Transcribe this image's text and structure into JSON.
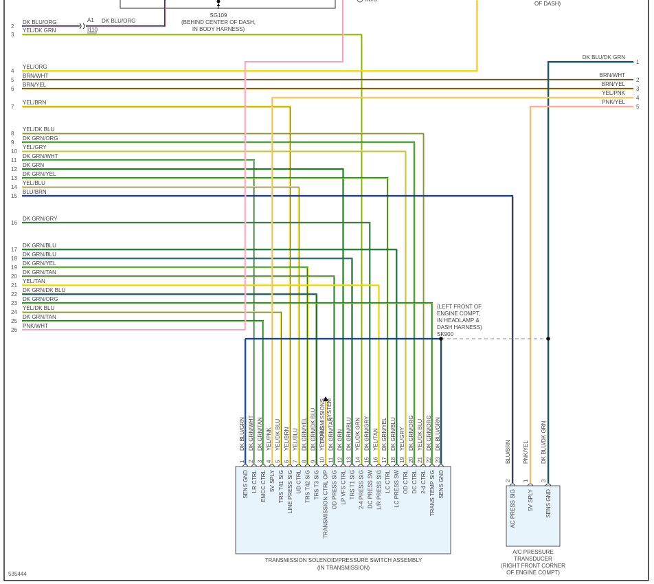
{
  "diagram_id": "535444",
  "colors": {
    "DK BLU": "#1a3a9c",
    "BLU": "#4a5ee0",
    "YEL": "#f2e600",
    "DK GRN": "#1f7f1f",
    "WHT": "#dddddd",
    "ORG": "#f2a050",
    "BRN": "#6b4a10",
    "GRY": "#9a9a9a",
    "TAN": "#d2b48c",
    "PNK": "#f4a0b8",
    "box_fill": "#e8f4fb"
  },
  "top": {
    "splice_id": "SG109",
    "splice_location": [
      "(BEHIND CENTER OF DASH,",
      "IN BODY HARNESS)"
    ],
    "awd_label": "AWD",
    "right_location_tail": "OF DASH)",
    "connector_a1": "A1",
    "connector_i110": "I110",
    "row2_right_label": "DK BLU/ORG"
  },
  "left_connector": {
    "wires": [
      {
        "cavity": "2",
        "label": "DK BLU/ORG",
        "colors": [
          "DK BLU",
          "ORG"
        ]
      },
      {
        "cavity": "3",
        "label": "YEL/DK GRN",
        "colors": [
          "YEL",
          "DK GRN"
        ]
      },
      {
        "cavity": "4",
        "label": "YEL/ORG",
        "colors": [
          "YEL",
          "ORG"
        ]
      },
      {
        "cavity": "5",
        "label": "BRN/WHT",
        "colors": [
          "BRN",
          "WHT"
        ],
        "to_right": "2"
      },
      {
        "cavity": "6",
        "label": "BRN/YEL",
        "colors": [
          "BRN",
          "YEL"
        ],
        "to_right": "3"
      },
      {
        "cavity": "7",
        "label": "YEL/BRN",
        "colors": [
          "YEL",
          "BRN"
        ],
        "to_pin": 6
      },
      {
        "cavity": "8",
        "label": "YEL/DK BLU",
        "colors": [
          "YEL",
          "DK BLU"
        ],
        "to_pin": 21
      },
      {
        "cavity": "9",
        "label": "DK GRN/ORG",
        "colors": [
          "DK GRN",
          "ORG"
        ],
        "to_pin": 20
      },
      {
        "cavity": "10",
        "label": "YEL/GRY",
        "colors": [
          "YEL",
          "GRY"
        ],
        "to_pin": 19
      },
      {
        "cavity": "11",
        "label": "DK GRN/WHT",
        "colors": [
          "DK GRN",
          "WHT"
        ],
        "to_pin": 2
      },
      {
        "cavity": "12",
        "label": "DK GRN",
        "colors": [
          "DK GRN",
          "DK GRN"
        ],
        "to_pin": 12
      },
      {
        "cavity": "13",
        "label": "DK GRN/YEL",
        "colors": [
          "DK GRN",
          "YEL"
        ],
        "to_pin": 17
      },
      {
        "cavity": "14",
        "label": "YEL/BLU",
        "colors": [
          "YEL",
          "BLU"
        ],
        "to_pin": 7
      },
      {
        "cavity": "15",
        "label": "BLU/BRN",
        "colors": [
          "DK BLU",
          "BRN"
        ],
        "to_ac_pin": "2"
      },
      {
        "cavity": "16",
        "label": "DK GRN/GRY",
        "colors": [
          "DK GRN",
          "GRY"
        ],
        "to_pin": 15
      },
      {
        "cavity": "17",
        "label": "DK GRN/BLU",
        "colors": [
          "DK GRN",
          "BLU"
        ],
        "to_pin": 18
      },
      {
        "cavity": "18",
        "label": "DK GRN/BLU",
        "colors": [
          "DK GRN",
          "BLU"
        ],
        "to_pin": 13
      },
      {
        "cavity": "19",
        "label": "DK GRN/YEL",
        "colors": [
          "DK GRN",
          "YEL"
        ],
        "to_pin": 8
      },
      {
        "cavity": "20",
        "label": "DK GRN/TAN",
        "colors": [
          "DK GRN",
          "TAN"
        ],
        "to_pin": 11
      },
      {
        "cavity": "21",
        "label": "YEL/TAN",
        "colors": [
          "YEL",
          "TAN"
        ],
        "to_pin": 16
      },
      {
        "cavity": "22",
        "label": "DK GRN/DK BLU",
        "colors": [
          "DK GRN",
          "DK BLU"
        ],
        "to_pin": 9
      },
      {
        "cavity": "23",
        "label": "DK GRN/ORG",
        "colors": [
          "DK GRN",
          "ORG"
        ],
        "to_pin": 22
      },
      {
        "cavity": "24",
        "label": "YEL/DK BLU",
        "colors": [
          "YEL",
          "DK BLU"
        ],
        "to_pin": 5
      },
      {
        "cavity": "25",
        "label": "DK GRN/TAN",
        "colors": [
          "DK GRN",
          "TAN"
        ],
        "to_pin": 3
      },
      {
        "cavity": "26",
        "label": "PNK/WHT",
        "colors": [
          "PNK",
          "WHT"
        ]
      }
    ]
  },
  "right_connector": {
    "wires": [
      {
        "cavity": "1",
        "label": "DK BLU/DK GRN",
        "colors": [
          "DK BLU",
          "DK GRN"
        ]
      },
      {
        "cavity": "2",
        "label": "BRN/WHT",
        "colors": [
          "BRN",
          "WHT"
        ]
      },
      {
        "cavity": "3",
        "label": "BRN/YEL",
        "colors": [
          "BRN",
          "YEL"
        ]
      },
      {
        "cavity": "4",
        "label": "YEL/PNK",
        "colors": [
          "YEL",
          "PNK"
        ]
      },
      {
        "cavity": "5",
        "label": "PNK/YEL",
        "colors": [
          "PNK",
          "YEL"
        ]
      }
    ]
  },
  "splice_sk900": {
    "id": "SK900",
    "location": [
      "(LEFT FRONT OF",
      "ENGINE COMPT,",
      "IN HEADLAMP &",
      "DASH HARNESS)"
    ]
  },
  "arrow_note": [
    "TRANSMISSIONS",
    "SYSTEM"
  ],
  "solenoid_assembly": {
    "title": "TRANSMISSION SOLENOID/PRESSURE SWITCH ASSEMBLY",
    "subtitle": "(IN TRANSMISSION)",
    "pins": [
      {
        "pin": "1",
        "wire": "DK BLU/GRN",
        "function": "SENS GND",
        "colors": [
          "DK BLU",
          "DK GRN"
        ]
      },
      {
        "pin": "2",
        "wire": "DK GRN/WHT",
        "function": "LR CTRL",
        "colors": [
          "DK GRN",
          "WHT"
        ]
      },
      {
        "pin": "3",
        "wire": "DK GRN/TAN",
        "function": "EMCC CTRL",
        "colors": [
          "DK GRN",
          "TAN"
        ]
      },
      {
        "pin": "4",
        "wire": "YEL/PNK",
        "function": "5V SPLY",
        "colors": [
          "YEL",
          "PNK"
        ]
      },
      {
        "pin": "5",
        "wire": "YEL/DK BLU",
        "function": "TRS T41 SIG",
        "colors": [
          "YEL",
          "DK BLU"
        ]
      },
      {
        "pin": "6",
        "wire": "YEL/BRN",
        "function": "LINE PRESS SIG",
        "colors": [
          "YEL",
          "BRN"
        ]
      },
      {
        "pin": "7",
        "wire": "YEL/BLU",
        "function": "UD CTRL",
        "colors": [
          "YEL",
          "BLU"
        ]
      },
      {
        "pin": "8",
        "wire": "DK GRN/YEL",
        "function": "TRS T42 SIG",
        "colors": [
          "DK GRN",
          "YEL"
        ]
      },
      {
        "pin": "9",
        "wire": "DK GRN/DK BLU",
        "function": "TRS T3 SIG",
        "colors": [
          "DK GRN",
          "DK BLU"
        ]
      },
      {
        "pin": "10",
        "wire": "YEL/ORG",
        "function": "TRANSMISSION CTRL O/P",
        "colors": [
          "ORG",
          "YEL"
        ]
      },
      {
        "pin": "11",
        "wire": "DK GRN/TAN",
        "function": "OD PRESS SIG",
        "colors": [
          "DK GRN",
          "TAN"
        ]
      },
      {
        "pin": "12",
        "wire": "DK GRN",
        "function": "LP VFS CTRL",
        "colors": [
          "DK GRN",
          "DK GRN"
        ]
      },
      {
        "pin": "13",
        "wire": "DK GRN/BLU",
        "function": "TRS T1 SIG",
        "colors": [
          "DK GRN",
          "BLU"
        ]
      },
      {
        "pin": "14",
        "wire": "YEL/DK GRN",
        "function": "2-4 PRESS SIG",
        "colors": [
          "YEL",
          "DK GRN"
        ]
      },
      {
        "pin": "15",
        "wire": "DK GRN/GRY",
        "function": "DC PRESS SW",
        "colors": [
          "DK GRN",
          "GRY"
        ]
      },
      {
        "pin": "16",
        "wire": "YEL/TAN",
        "function": "L/R PRESS SIG",
        "colors": [
          "YEL",
          "TAN"
        ]
      },
      {
        "pin": "17",
        "wire": "DK GRN/YEL",
        "function": "LC CTRL",
        "colors": [
          "DK GRN",
          "YEL"
        ]
      },
      {
        "pin": "18",
        "wire": "DK GRN/BLU",
        "function": "LC PRESS SW",
        "colors": [
          "DK GRN",
          "BLU"
        ]
      },
      {
        "pin": "19",
        "wire": "YEL/GRY",
        "function": "OD CTRL",
        "colors": [
          "YEL",
          "GRY"
        ]
      },
      {
        "pin": "20",
        "wire": "DK GRN/ORG",
        "function": "DC CTRL",
        "colors": [
          "DK GRN",
          "ORG"
        ]
      },
      {
        "pin": "21",
        "wire": "YEL/DK BLU",
        "function": "2-4 CTRL",
        "colors": [
          "YEL",
          "DK BLU"
        ]
      },
      {
        "pin": "22",
        "wire": "DK GRN/ORG",
        "function": "TRANS TEMP SIG",
        "colors": [
          "DK GRN",
          "ORG"
        ]
      },
      {
        "pin": "23",
        "wire": "DK BLU/GRN",
        "function": "SENS GND",
        "colors": [
          "DK BLU",
          "DK GRN"
        ]
      }
    ]
  },
  "ac_transducer": {
    "title": [
      "A/C PRESSURE",
      "TRANSDUCER",
      "(RIGHT FRONT CORNER",
      "OF ENGINE COMPT)"
    ],
    "pins": [
      {
        "pin": "2",
        "wire": "BLU/BRN",
        "function": "AC PRESS SIG",
        "colors": [
          "BLU",
          "BRN"
        ]
      },
      {
        "pin": "1",
        "wire": "PNK/YEL",
        "function": "5V SPLY",
        "colors": [
          "PNK",
          "YEL"
        ]
      },
      {
        "pin": "3",
        "wire": "DK BLU/DK GRN",
        "function": "SENS GND",
        "colors": [
          "DK BLU",
          "DK GRN"
        ]
      }
    ]
  }
}
